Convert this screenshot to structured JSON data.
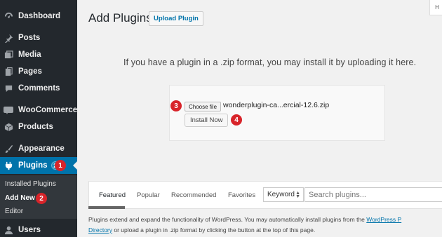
{
  "sidebar": {
    "items": [
      {
        "label": "Dashboard",
        "icon": "dashboard-icon"
      },
      {
        "label": "Posts",
        "icon": "pushpin-icon"
      },
      {
        "label": "Media",
        "icon": "media-icon"
      },
      {
        "label": "Pages",
        "icon": "pages-icon"
      },
      {
        "label": "Comments",
        "icon": "comment-icon"
      },
      {
        "label": "WooCommerce",
        "icon": "woocommerce-icon"
      },
      {
        "label": "Products",
        "icon": "box-icon"
      },
      {
        "label": "Appearance",
        "icon": "paintbrush-icon"
      },
      {
        "label": "Plugins",
        "icon": "plug-icon",
        "badge": "2"
      },
      {
        "label": "Users",
        "icon": "users-icon"
      }
    ],
    "submenu": [
      {
        "label": "Installed Plugins"
      },
      {
        "label": "Add New"
      },
      {
        "label": "Editor"
      }
    ],
    "colors": {
      "background": "#23282d",
      "active": "#0073aa",
      "submenu": "#32373c"
    }
  },
  "markers": [
    "1",
    "2",
    "3",
    "4"
  ],
  "header": {
    "title": "Add Plugins",
    "upload_button": "Upload Plugin",
    "help_tab": "H"
  },
  "upload": {
    "message": "If you have a plugin in a .zip format, you may install it by uploading it here.",
    "choose_file": "Choose file",
    "file_name": "wonderplugin-ca...ercial-12.6.zip",
    "install_button": "Install Now"
  },
  "filters": {
    "tabs": [
      "Featured",
      "Popular",
      "Recommended",
      "Favorites"
    ],
    "active_tab": "Featured",
    "select_value": "Keyword",
    "search_placeholder": "Search plugins..."
  },
  "help_text": {
    "part1": "Plugins extend and expand the functionality of WordPress. You may automatically install plugins from the ",
    "link1a": "WordPress P",
    "link1b": "Directory",
    "part2": " or upload a plugin in .zip format by clicking the button at the top of this page."
  },
  "colors": {
    "accent": "#0073aa",
    "marker": "#d8242a"
  }
}
